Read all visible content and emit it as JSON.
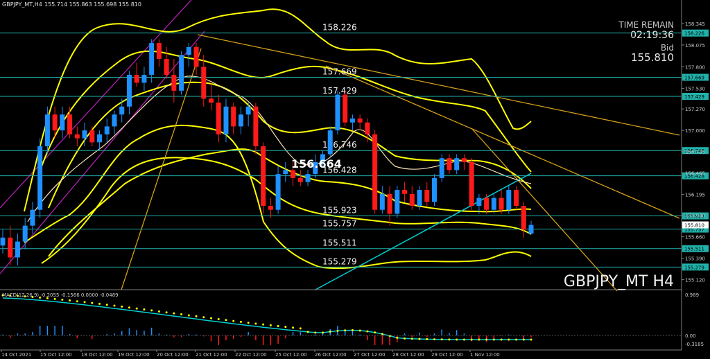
{
  "header": {
    "symbol_tf": "GBPJPY_MT,H4",
    "ohlc": "155.714 155.863 155.698 155.810"
  },
  "info": {
    "time_remain_label": "TIME REMAIN",
    "time_remain_value": "02:19:36",
    "bid_label": "Bid",
    "bid_value": "155.810"
  },
  "watermark": "GBPJPY_MT H4",
  "big_price_label": "156.664",
  "macd_header": "MACD(12,26,9) -0.2055 -0.1566 0.0000 -0.0489",
  "colors": {
    "background": "#000000",
    "bull_candle": "#1e90ff",
    "bear_candle": "#ff1a1a",
    "bands": "#ffff00",
    "level_line": "#20b2aa",
    "trend_line": "#d4a017",
    "ma_white": "#f5deb3",
    "ma_cyan": "#00ced1",
    "macd_signal": "#ffff00"
  },
  "chart_data": {
    "type": "candlestick",
    "price_axis_ticks": [
      "158.345",
      "158.075",
      "157.800",
      "157.530",
      "157.270",
      "157.000",
      "156.735",
      "156.465",
      "156.195",
      "155.930",
      "155.660",
      "155.390",
      "155.120"
    ],
    "ylim": [
      155.02,
      158.52
    ],
    "levels": [
      {
        "value": 158.226,
        "label": "158.226"
      },
      {
        "value": 157.669,
        "label": "157.669"
      },
      {
        "value": 157.429,
        "label": "157.429"
      },
      {
        "value": 156.746,
        "label": "156.746"
      },
      {
        "value": 156.428,
        "label": "156.428"
      },
      {
        "value": 155.923,
        "label": "155.923"
      },
      {
        "value": 155.757,
        "label": "155.757"
      },
      {
        "value": 155.511,
        "label": "155.511"
      },
      {
        "value": 155.279,
        "label": "155.279"
      }
    ],
    "current_price": {
      "value": 155.81,
      "label": "155.810"
    },
    "time_axis_labels": [
      "14 Oct 2021",
      "15 Oct 12:00",
      "18 Oct 12:00",
      "19 Oct 12:00",
      "20 Oct 12:00",
      "21 Oct 12:00",
      "22 Oct 12:00",
      "25 Oct 12:00",
      "26 Oct 12:00",
      "27 Oct 12:00",
      "28 Oct 12:00",
      "29 Oct 12:00",
      "1 Nov 12:00"
    ],
    "macd_axis_ticks": [
      "0.989",
      "0.00",
      "-0.3185"
    ],
    "candles": [
      [
        155.55,
        155.75,
        155.45,
        155.65
      ],
      [
        155.65,
        155.8,
        155.3,
        155.4
      ],
      [
        155.4,
        155.7,
        155.3,
        155.6
      ],
      [
        155.6,
        155.9,
        155.5,
        155.8
      ],
      [
        155.8,
        156.1,
        155.7,
        156.0
      ],
      [
        156.0,
        156.9,
        155.9,
        156.8
      ],
      [
        156.8,
        157.3,
        156.7,
        157.2
      ],
      [
        157.2,
        157.3,
        156.9,
        157.0
      ],
      [
        157.0,
        157.3,
        156.9,
        157.2
      ],
      [
        157.2,
        157.3,
        156.9,
        156.95
      ],
      [
        156.95,
        157.05,
        156.8,
        156.9
      ],
      [
        156.9,
        157.1,
        156.8,
        157.0
      ],
      [
        157.0,
        157.05,
        156.8,
        156.85
      ],
      [
        156.85,
        157.0,
        156.75,
        156.95
      ],
      [
        156.95,
        157.15,
        156.85,
        157.05
      ],
      [
        157.05,
        157.25,
        156.95,
        157.2
      ],
      [
        157.2,
        157.4,
        157.1,
        157.3
      ],
      [
        157.3,
        157.75,
        157.2,
        157.7
      ],
      [
        157.7,
        157.85,
        157.55,
        157.6
      ],
      [
        157.6,
        157.8,
        157.5,
        157.7
      ],
      [
        157.7,
        158.15,
        157.6,
        158.1
      ],
      [
        158.1,
        158.15,
        157.8,
        157.9
      ],
      [
        157.9,
        158.05,
        157.65,
        157.7
      ],
      [
        157.7,
        157.9,
        157.35,
        157.5
      ],
      [
        157.5,
        158.0,
        157.45,
        157.95
      ],
      [
        157.95,
        158.1,
        157.8,
        158.05
      ],
      [
        158.05,
        158.1,
        157.7,
        157.8
      ],
      [
        157.8,
        157.95,
        157.3,
        157.4
      ],
      [
        157.4,
        157.6,
        157.25,
        157.35
      ],
      [
        157.35,
        157.45,
        156.85,
        156.95
      ],
      [
        156.95,
        157.4,
        156.85,
        157.3
      ],
      [
        157.3,
        157.35,
        156.95,
        157.05
      ],
      [
        157.05,
        157.3,
        156.95,
        157.2
      ],
      [
        157.2,
        157.35,
        157.05,
        157.3
      ],
      [
        157.3,
        157.35,
        156.7,
        156.8
      ],
      [
        156.8,
        156.85,
        155.95,
        156.05
      ],
      [
        156.05,
        156.15,
        155.9,
        156.0
      ],
      [
        156.0,
        156.55,
        155.95,
        156.45
      ],
      [
        156.45,
        156.6,
        156.35,
        156.5
      ],
      [
        156.5,
        156.6,
        156.3,
        156.4
      ],
      [
        156.4,
        156.5,
        156.3,
        156.35
      ],
      [
        156.35,
        156.5,
        156.3,
        156.45
      ],
      [
        156.45,
        156.7,
        156.4,
        156.6
      ],
      [
        156.6,
        156.75,
        156.55,
        156.7
      ],
      [
        156.7,
        157.05,
        156.65,
        157.0
      ],
      [
        157.0,
        157.5,
        156.95,
        157.45
      ],
      [
        157.45,
        157.5,
        157.05,
        157.1
      ],
      [
        157.1,
        157.2,
        157.0,
        157.15
      ],
      [
        157.15,
        157.2,
        157.0,
        157.1
      ],
      [
        157.1,
        157.15,
        156.85,
        156.95
      ],
      [
        156.95,
        157.0,
        155.95,
        156.0
      ],
      [
        156.0,
        156.3,
        155.95,
        156.2
      ],
      [
        156.2,
        156.3,
        155.8,
        155.95
      ],
      [
        155.95,
        156.3,
        155.9,
        156.25
      ],
      [
        156.25,
        156.35,
        156.1,
        156.2
      ],
      [
        156.2,
        156.3,
        156.0,
        156.05
      ],
      [
        156.05,
        156.3,
        156.0,
        156.25
      ],
      [
        156.25,
        156.35,
        156.05,
        156.1
      ],
      [
        156.1,
        156.45,
        156.05,
        156.4
      ],
      [
        156.4,
        156.7,
        156.35,
        156.65
      ],
      [
        156.65,
        156.7,
        156.45,
        156.5
      ],
      [
        156.5,
        156.7,
        156.45,
        156.65
      ],
      [
        156.65,
        156.7,
        156.5,
        156.6
      ],
      [
        156.6,
        156.65,
        156.0,
        156.05
      ],
      [
        156.05,
        156.2,
        155.95,
        156.15
      ],
      [
        156.15,
        156.2,
        155.95,
        156.0
      ],
      [
        156.0,
        156.2,
        155.95,
        156.15
      ],
      [
        156.15,
        156.25,
        155.95,
        156.0
      ],
      [
        156.0,
        156.3,
        155.95,
        156.25
      ],
      [
        156.25,
        156.3,
        156.0,
        156.05
      ],
      [
        156.05,
        156.1,
        155.65,
        155.75
      ],
      [
        155.7,
        155.86,
        155.69,
        155.81
      ]
    ]
  }
}
